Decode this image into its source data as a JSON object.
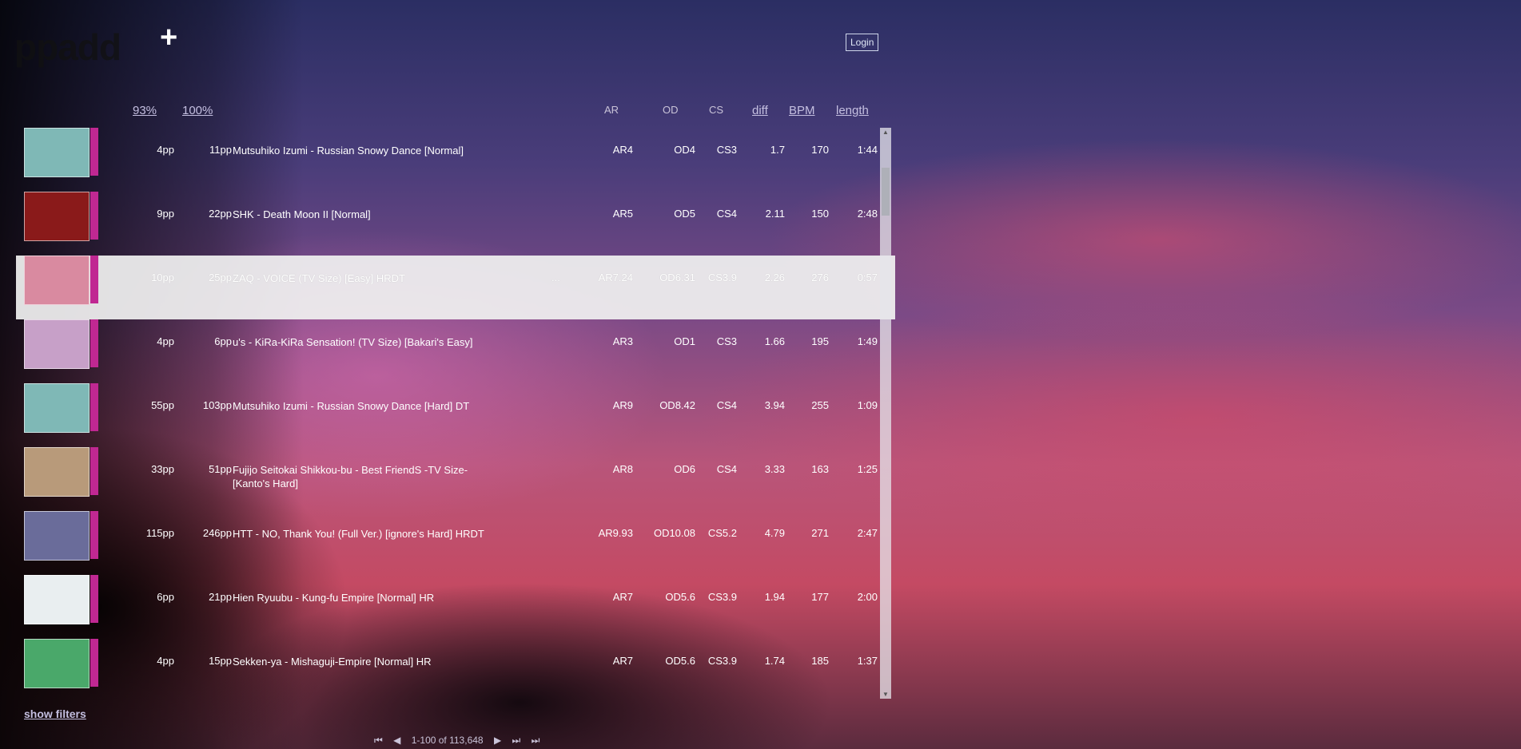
{
  "app": {
    "logo": "ppadd",
    "add_label": "+",
    "login_label": "Login"
  },
  "columns": {
    "pp93": "93%",
    "pp100": "100%",
    "ar": "AR",
    "od": "OD",
    "cs": "CS",
    "diff": "diff",
    "bpm": "BPM",
    "length": "length"
  },
  "rows": [
    {
      "pp93": "4pp",
      "pp100": "11pp",
      "title": "Mutsuhiko Izumi - Russian Snowy Dance [Normal]",
      "ar": "AR4",
      "od": "OD4",
      "cs": "CS3",
      "diff": "1.7",
      "bpm": "170",
      "length": "1:44",
      "thumb_color": "#7fb8b6"
    },
    {
      "pp93": "9pp",
      "pp100": "22pp",
      "title": "SHK - Death Moon II [Normal]",
      "ar": "AR5",
      "od": "OD5",
      "cs": "CS4",
      "diff": "2.11",
      "bpm": "150",
      "length": "2:48",
      "thumb_color": "#8a1a1a"
    },
    {
      "pp93": "10pp",
      "pp100": "25pp",
      "title": "ZAQ - VOICE (TV Size) [Easy] HRDT",
      "extra": "...",
      "ar": "AR7.24",
      "od": "OD6.31",
      "cs": "CS3.9",
      "diff": "2.26",
      "bpm": "276",
      "length": "0:57",
      "selected": true,
      "thumb_color": "#d98aa0"
    },
    {
      "pp93": "4pp",
      "pp100": "6pp",
      "title": "u's - KiRa-KiRa Sensation! (TV Size) [Bakari's Easy]",
      "ar": "AR3",
      "od": "OD1",
      "cs": "CS3",
      "diff": "1.66",
      "bpm": "195",
      "length": "1:49",
      "thumb_color": "#c7a0c8"
    },
    {
      "pp93": "55pp",
      "pp100": "103pp",
      "title": "Mutsuhiko Izumi - Russian Snowy Dance [Hard] DT",
      "ar": "AR9",
      "od": "OD8.42",
      "cs": "CS4",
      "diff": "3.94",
      "bpm": "255",
      "length": "1:09",
      "thumb_color": "#7fb8b6"
    },
    {
      "pp93": "33pp",
      "pp100": "51pp",
      "title": "Fujijo Seitokai Shikkou-bu - Best FriendS -TV Size- [Kanto's Hard]",
      "ar": "AR8",
      "od": "OD6",
      "cs": "CS4",
      "diff": "3.33",
      "bpm": "163",
      "length": "1:25",
      "thumb_color": "#b89a7a"
    },
    {
      "pp93": "115pp",
      "pp100": "246pp",
      "title": "HTT - NO, Thank You! (Full Ver.) [ignore's Hard] HRDT",
      "ar": "AR9.93",
      "od": "OD10.08",
      "cs": "CS5.2",
      "diff": "4.79",
      "bpm": "271",
      "length": "2:47",
      "thumb_color": "#6a6c9a"
    },
    {
      "pp93": "6pp",
      "pp100": "21pp",
      "title": "Hien Ryuubu - Kung-fu Empire [Normal] HR",
      "ar": "AR7",
      "od": "OD5.6",
      "cs": "CS3.9",
      "diff": "1.94",
      "bpm": "177",
      "length": "2:00",
      "thumb_color": "#e9eef0"
    },
    {
      "pp93": "4pp",
      "pp100": "15pp",
      "title": "Sekken-ya - Mishaguji-Empire [Normal] HR",
      "ar": "AR7",
      "od": "OD5.6",
      "cs": "CS3.9",
      "diff": "1.74",
      "bpm": "185",
      "length": "1:37",
      "thumb_color": "#4aa86a"
    }
  ],
  "footer": {
    "show_filters": "show filters",
    "pagination": "1-100 of 113,648"
  },
  "colors": {
    "strip": "#c02892",
    "selected_row": "#f0f0f0"
  }
}
